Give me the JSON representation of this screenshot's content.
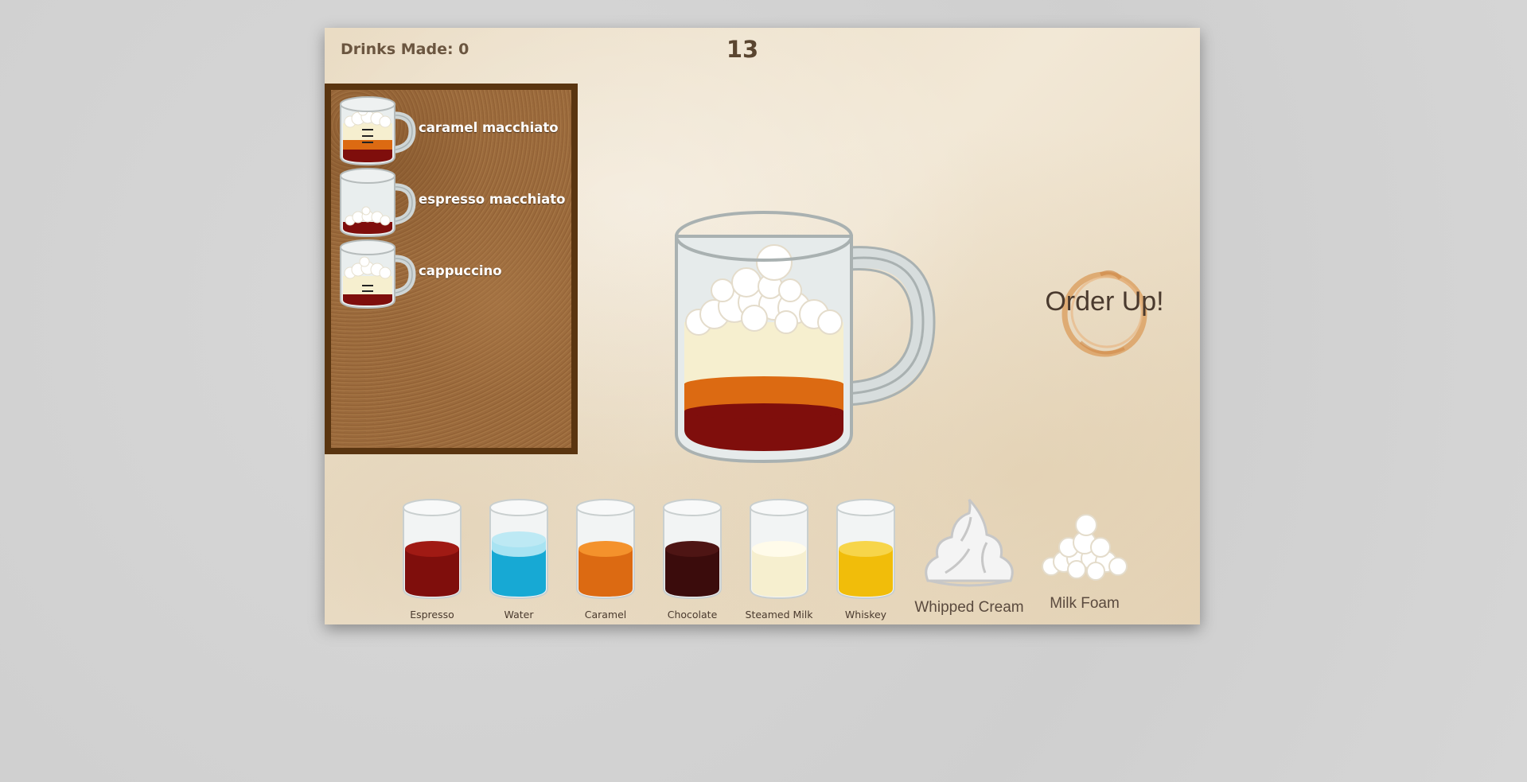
{
  "hud": {
    "drinks_made_label": "Drinks Made: 0",
    "timer": "13"
  },
  "orders": [
    {
      "name": "caramel macchiato",
      "layers": [
        "espresso",
        "caramel",
        "steamed_milk",
        "milk_foam"
      ]
    },
    {
      "name": "espresso macchiato",
      "layers": [
        "espresso",
        "milk_foam"
      ]
    },
    {
      "name": "cappuccino",
      "layers": [
        "espresso",
        "steamed_milk",
        "milk_foam"
      ]
    }
  ],
  "current_mug": {
    "layers": [
      "espresso",
      "caramel",
      "steamed_milk",
      "milk_foam"
    ]
  },
  "order_up": {
    "label": "Order Up!"
  },
  "ingredients": [
    {
      "name": "Espresso",
      "color": "#7f0e0c",
      "top": "#a01a14"
    },
    {
      "name": "Water",
      "color": "#17a9d4",
      "top": "#a8e3f2"
    },
    {
      "name": "Caramel",
      "color": "#dc6a12",
      "top": "#f4922c"
    },
    {
      "name": "Chocolate",
      "color": "#3b0c0c",
      "top": "#4e1514"
    },
    {
      "name": "Steamed Milk",
      "color": "#f6efcf",
      "top": "#fffbea"
    },
    {
      "name": "Whiskey",
      "color": "#f1bd0a",
      "top": "#f7d54a"
    }
  ],
  "toppings": [
    {
      "name": "Whipped Cream"
    },
    {
      "name": "Milk Foam"
    }
  ],
  "colors": {
    "espresso": "#7f0e0c",
    "caramel": "#dc6a12",
    "steamed_milk": "#f6efcf",
    "board_frame": "#5a3510",
    "ring": "#d99a5a"
  }
}
